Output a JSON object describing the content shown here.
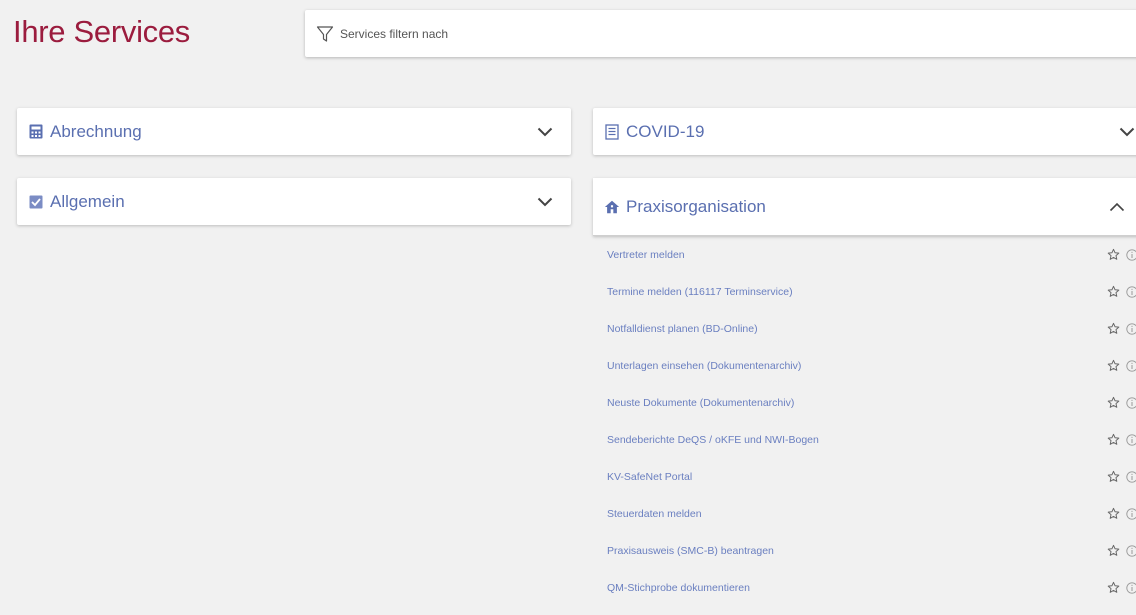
{
  "header": {
    "title": "Ihre Services",
    "filter_placeholder": "Services filtern nach"
  },
  "colors": {
    "title": "#9b1c3e",
    "link": "#6a7fc0",
    "panel_label": "#5a6fb0",
    "background": "#f1f1f1"
  },
  "panels": {
    "abrechnung": {
      "label": "Abrechnung",
      "icon": "calculator-icon",
      "expanded": false
    },
    "allgemein": {
      "label": "Allgemein",
      "icon": "checkbox-icon",
      "expanded": false
    },
    "covid": {
      "label": "COVID-19",
      "icon": "document-list-icon",
      "expanded": false
    },
    "praxis": {
      "label": "Praxisorganisation",
      "icon": "home-icon",
      "expanded": true,
      "items": [
        {
          "label": "Vertreter melden"
        },
        {
          "label": "Termine melden (116117 Terminservice)"
        },
        {
          "label": "Notfalldienst planen (BD-Online)"
        },
        {
          "label": "Unterlagen einsehen (Dokumentenarchiv)"
        },
        {
          "label": "Neuste Dokumente (Dokumentenarchiv)"
        },
        {
          "label": "Sendeberichte DeQS / oKFE und NWI-Bogen"
        },
        {
          "label": "KV-SafeNet Portal"
        },
        {
          "label": "Steuerdaten melden"
        },
        {
          "label": "Praxisausweis (SMC-B) beantragen"
        },
        {
          "label": "QM-Stichprobe dokumentieren"
        }
      ]
    }
  }
}
